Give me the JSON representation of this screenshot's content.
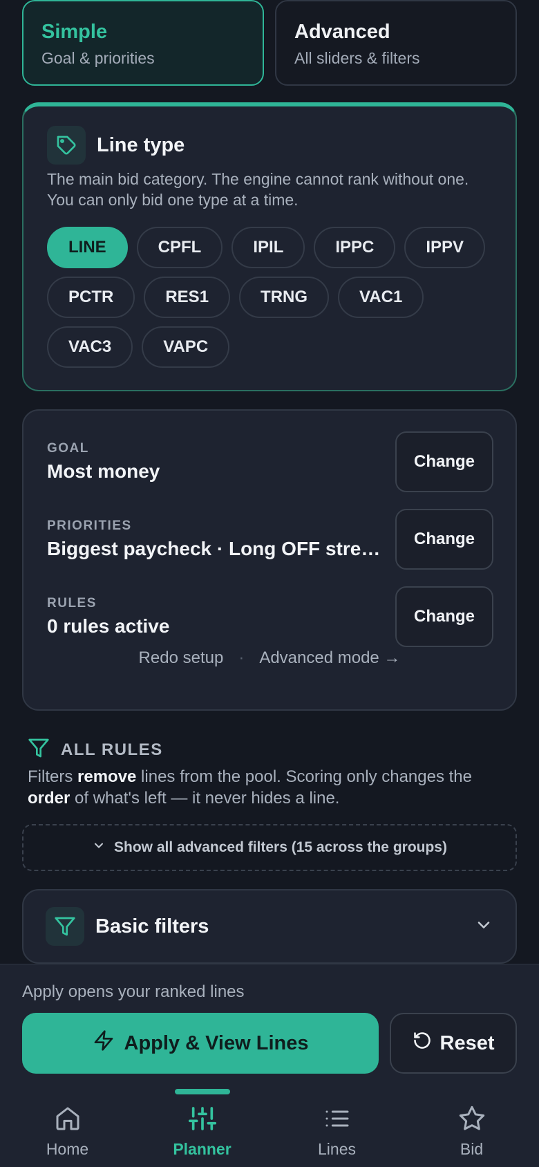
{
  "mode_toggle": {
    "simple": {
      "title": "Simple",
      "subtitle": "Goal & priorities"
    },
    "advanced": {
      "title": "Advanced",
      "subtitle": "All sliders & filters"
    }
  },
  "line_type": {
    "title": "Line type",
    "description": "The main bid category. The engine cannot rank without one. You can only bid one type at a time.",
    "chips": [
      {
        "label": "LINE",
        "selected": true
      },
      {
        "label": "CPFL",
        "selected": false
      },
      {
        "label": "IPIL",
        "selected": false
      },
      {
        "label": "IPPC",
        "selected": false
      },
      {
        "label": "IPPV",
        "selected": false
      },
      {
        "label": "PCTR",
        "selected": false
      },
      {
        "label": "RES1",
        "selected": false
      },
      {
        "label": "TRNG",
        "selected": false
      },
      {
        "label": "VAC1",
        "selected": false
      },
      {
        "label": "VAC3",
        "selected": false
      },
      {
        "label": "VAPC",
        "selected": false
      }
    ]
  },
  "summary": {
    "rows": [
      {
        "label": "GOAL",
        "value": "Most money",
        "button": "Change"
      },
      {
        "label": "PRIORITIES",
        "value": "Biggest paycheck · Long OFF stretches",
        "button": "Change"
      },
      {
        "label": "RULES",
        "value": "0 rules active",
        "button": "Change"
      }
    ],
    "redo_setup": "Redo setup",
    "separator": "·",
    "advanced_mode": "Advanced mode →"
  },
  "all_rules": {
    "title": "ALL RULES",
    "desc_part1": "Filters ",
    "desc_bold1": "remove",
    "desc_part2": " lines from the pool. Scoring only changes the ",
    "desc_bold2": "order",
    "desc_part3": " of what's left — it never hides a line.",
    "show_advanced": "Show all advanced filters (15 across the groups)"
  },
  "basic_filters": {
    "title": "Basic filters"
  },
  "actions": {
    "hint": "Apply opens your ranked lines",
    "apply": "Apply & View Lines",
    "reset": "Reset"
  },
  "nav": {
    "items": [
      {
        "label": "Home",
        "icon": "home-icon"
      },
      {
        "label": "Planner",
        "icon": "sliders-icon",
        "active": true
      },
      {
        "label": "Lines",
        "icon": "list-icon"
      },
      {
        "label": "Bid",
        "icon": "star-icon"
      }
    ]
  },
  "colors": {
    "accent": "#2fb597",
    "background": "#141821",
    "card": "#1e2330"
  }
}
